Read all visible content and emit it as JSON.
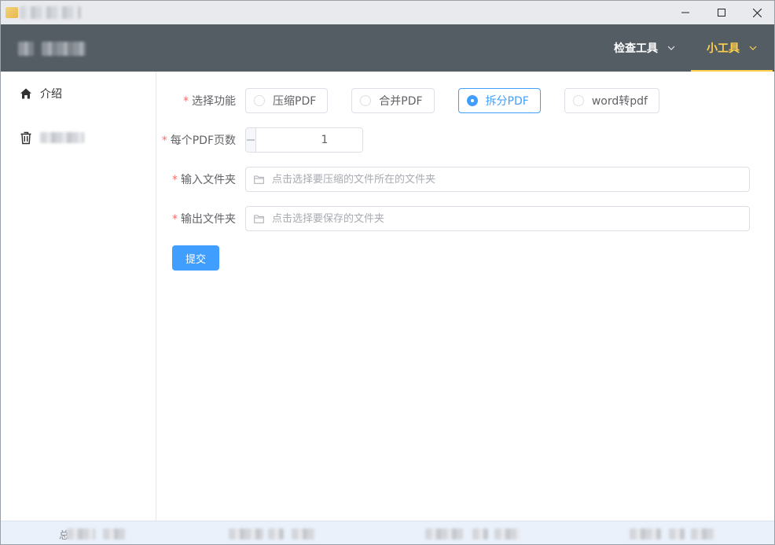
{
  "window": {
    "controls": {
      "minimize_icon": "minimize-icon",
      "maximize_icon": "maximize-icon",
      "close_icon": "close-icon"
    }
  },
  "header": {
    "nav": [
      {
        "label": "检查工具",
        "active": false
      },
      {
        "label": "小工具",
        "active": true
      }
    ],
    "active_color": "#ffd04b",
    "background": "#545c64"
  },
  "sidebar": {
    "items": [
      {
        "label": "介绍",
        "icon": "home-icon"
      },
      {
        "label": "",
        "icon": "trash-icon"
      }
    ]
  },
  "form": {
    "function": {
      "label": "选择功能",
      "options": [
        "压缩PDF",
        "合并PDF",
        "拆分PDF",
        "word转pdf"
      ],
      "selected": "拆分PDF"
    },
    "pages_per_pdf": {
      "label": "每个PDF页数",
      "value": "1"
    },
    "input_folder": {
      "label": "输入文件夹",
      "placeholder": "点击选择要压缩的文件所在的文件夹"
    },
    "output_folder": {
      "label": "输出文件夹",
      "placeholder": "点击选择要保存的文件夹"
    },
    "submit_label": "提交"
  },
  "statusbar": {
    "visible_char": "总"
  },
  "colors": {
    "primary": "#409eff",
    "required": "#f56c6c"
  }
}
